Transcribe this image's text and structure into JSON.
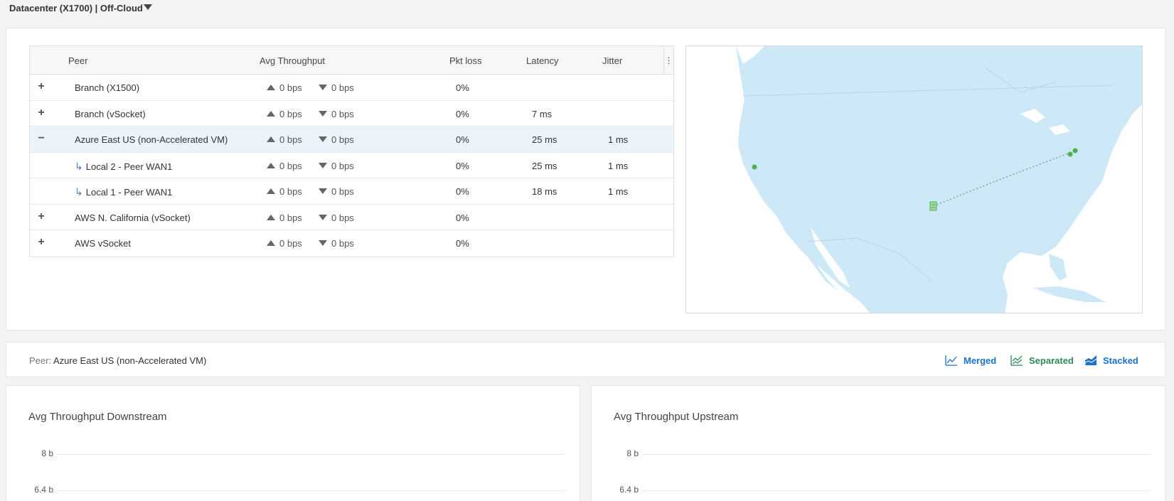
{
  "header": {
    "title": "Datacenter (X1700) | Off-Cloud"
  },
  "table": {
    "columns": {
      "peer": "Peer",
      "throughput": "Avg Throughput",
      "pkt_loss": "Pkt loss",
      "latency": "Latency",
      "jitter": "Jitter"
    },
    "rows": [
      {
        "toggle": "+",
        "peer": "Branch (X1500)",
        "up": "0 bps",
        "down": "0 bps",
        "pkt_loss": "0%",
        "latency": "",
        "jitter": ""
      },
      {
        "toggle": "+",
        "peer": "Branch (vSocket)",
        "up": "0 bps",
        "down": "0 bps",
        "pkt_loss": "0%",
        "latency": "7 ms",
        "jitter": ""
      },
      {
        "toggle": "−",
        "peer": "Azure East US (non-Accelerated VM)",
        "up": "0 bps",
        "down": "0 bps",
        "pkt_loss": "0%",
        "latency": "25 ms",
        "jitter": "1 ms"
      },
      {
        "toggle": "",
        "peer": "Local 2 - Peer WAN1",
        "up": "0 bps",
        "down": "0 bps",
        "pkt_loss": "0%",
        "latency": "25 ms",
        "jitter": "1 ms"
      },
      {
        "toggle": "",
        "peer": "Local 1 - Peer WAN1",
        "up": "0 bps",
        "down": "0 bps",
        "pkt_loss": "0%",
        "latency": "18 ms",
        "jitter": "1 ms"
      },
      {
        "toggle": "+",
        "peer": "AWS N. California (vSocket)",
        "up": "0 bps",
        "down": "0 bps",
        "pkt_loss": "0%",
        "latency": "",
        "jitter": ""
      },
      {
        "toggle": "+",
        "peer": "AWS vSocket",
        "up": "0 bps",
        "down": "0 bps",
        "pkt_loss": "0%",
        "latency": "",
        "jitter": ""
      }
    ]
  },
  "peer_bar": {
    "label": "Peer:",
    "value": "Azure East US (non-Accelerated VM)",
    "views": {
      "merged": "Merged",
      "separated": "Separated",
      "stacked": "Stacked"
    }
  },
  "colors": {
    "accent_blue": "#1a73c8",
    "accent_green": "#2e8b57",
    "map_land": "#cde8f7",
    "map_dot": "#4caf50"
  },
  "charts": {
    "downstream": {
      "title": "Avg Throughput Downstream",
      "ticks": [
        "8 b",
        "6.4 b"
      ]
    },
    "upstream": {
      "title": "Avg Throughput Upstream",
      "ticks": [
        "8 b",
        "6.4 b"
      ]
    }
  }
}
